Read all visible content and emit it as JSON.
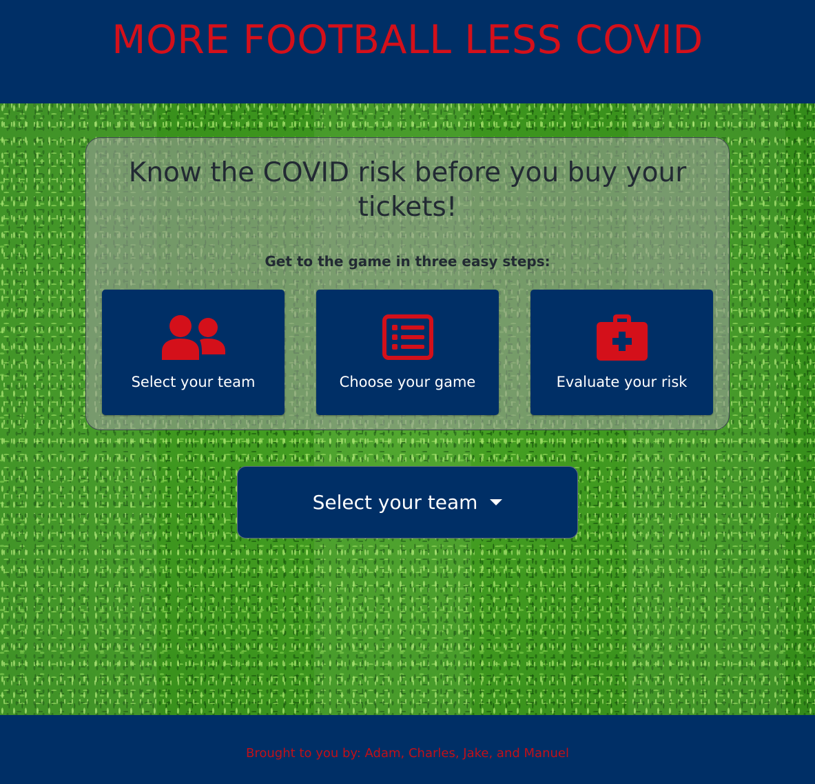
{
  "header": {
    "title": "MORE FOOTBALL LESS COVID"
  },
  "card": {
    "heading": "Know the COVID risk before you buy your tickets!",
    "subheading": "Get to the game in three easy steps:",
    "steps": [
      {
        "label": "Select your team",
        "icon": "users-icon"
      },
      {
        "label": "Choose your game",
        "icon": "list-icon"
      },
      {
        "label": "Evaluate your risk",
        "icon": "medkit-icon"
      }
    ]
  },
  "dropdown": {
    "label": "Select your team",
    "icon": "caret-down-icon"
  },
  "footer": {
    "credit": "Brought to you by: Adam, Charles, Jake, and Manuel"
  },
  "colors": {
    "navy": "#002f66",
    "accent_red": "#d4101a",
    "grass_green": "#3f9a1c"
  }
}
